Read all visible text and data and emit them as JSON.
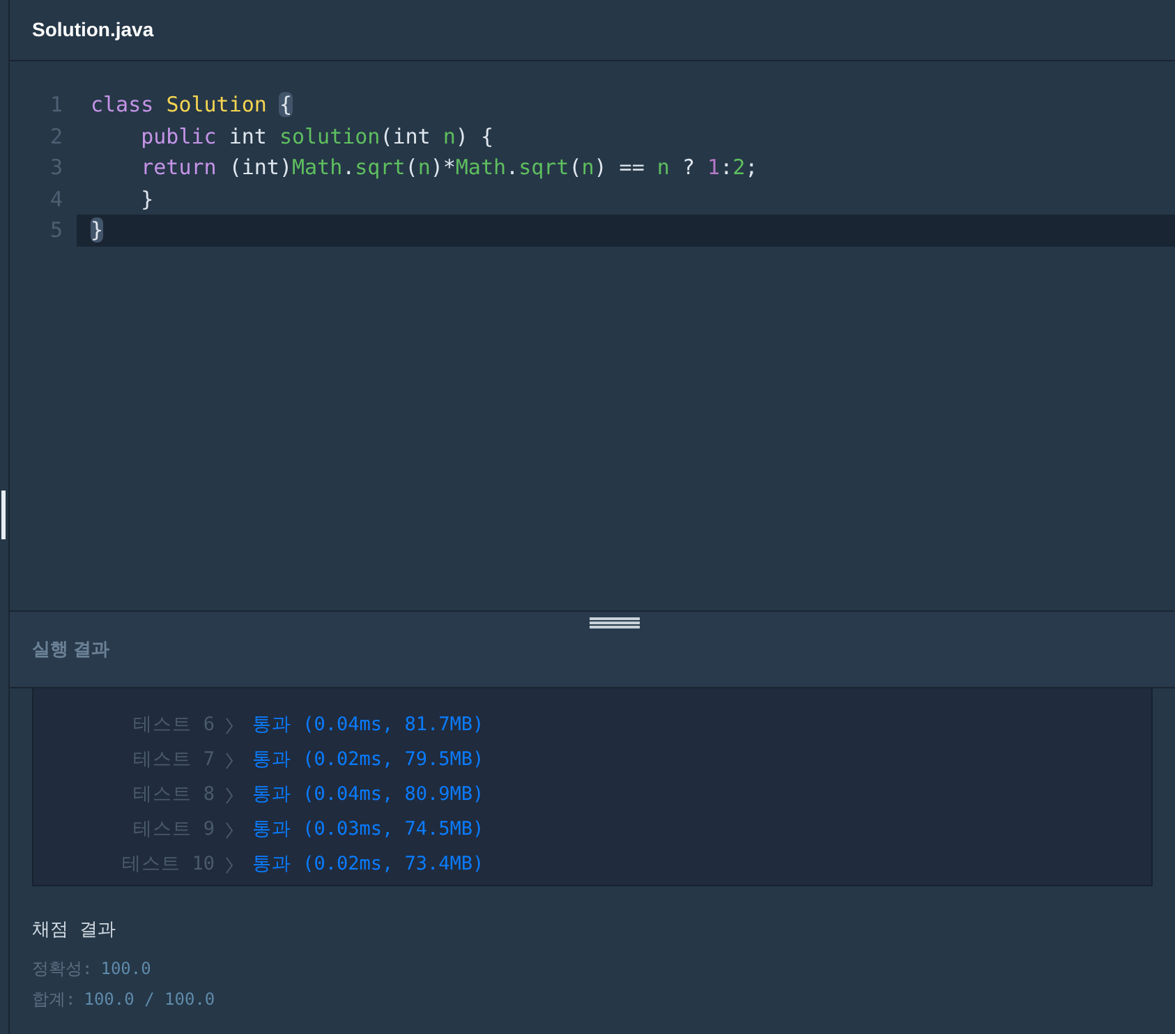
{
  "editor": {
    "file_tab": "Solution.java",
    "lines": [
      {
        "number": "1",
        "active": false,
        "tokens": [
          {
            "text": "class ",
            "kind": "keyword"
          },
          {
            "text": "Solution ",
            "kind": "type"
          },
          {
            "text": "{",
            "kind": "bracket"
          }
        ]
      },
      {
        "number": "2",
        "active": false,
        "tokens": [
          {
            "text": "    public",
            "kind": "keyword"
          },
          {
            "text": " int ",
            "kind": "plain"
          },
          {
            "text": "solution",
            "kind": "function"
          },
          {
            "text": "(int ",
            "kind": "plain"
          },
          {
            "text": "n",
            "kind": "function"
          },
          {
            "text": ") {",
            "kind": "plain"
          }
        ]
      },
      {
        "number": "3",
        "active": false,
        "tokens": [
          {
            "text": "    return",
            "kind": "keyword"
          },
          {
            "text": " (int)",
            "kind": "plain"
          },
          {
            "text": "Math",
            "kind": "function"
          },
          {
            "text": ".",
            "kind": "plain"
          },
          {
            "text": "sqrt",
            "kind": "function"
          },
          {
            "text": "(",
            "kind": "plain"
          },
          {
            "text": "n",
            "kind": "function"
          },
          {
            "text": ")*",
            "kind": "plain"
          },
          {
            "text": "Math",
            "kind": "function"
          },
          {
            "text": ".",
            "kind": "plain"
          },
          {
            "text": "sqrt",
            "kind": "function"
          },
          {
            "text": "(",
            "kind": "plain"
          },
          {
            "text": "n",
            "kind": "function"
          },
          {
            "text": ") == ",
            "kind": "plain"
          },
          {
            "text": "n",
            "kind": "function"
          },
          {
            "text": " ? ",
            "kind": "plain"
          },
          {
            "text": "1",
            "kind": "number"
          },
          {
            "text": ":",
            "kind": "plain"
          },
          {
            "text": "2",
            "kind": "function"
          },
          {
            "text": ";",
            "kind": "plain"
          }
        ]
      },
      {
        "number": "4",
        "active": false,
        "tokens": [
          {
            "text": "    }",
            "kind": "plain"
          }
        ]
      },
      {
        "number": "5",
        "active": true,
        "tokens": [
          {
            "text": "}",
            "kind": "bracket"
          }
        ]
      }
    ]
  },
  "run_results": {
    "title": "실행 결과",
    "rows": [
      {
        "test": "테스트 6",
        "result": "통과 (0.04ms, 81.7MB)"
      },
      {
        "test": "테스트 7",
        "result": "통과 (0.02ms, 79.5MB)"
      },
      {
        "test": "테스트 8",
        "result": "통과 (0.04ms, 80.9MB)"
      },
      {
        "test": "테스트 9",
        "result": "통과 (0.03ms, 74.5MB)"
      },
      {
        "test": "테스트 10",
        "result": "통과 (0.02ms, 73.4MB)"
      }
    ]
  },
  "grading": {
    "title": "채점 결과",
    "lines": [
      {
        "label": "정확성:",
        "value": "100.0"
      },
      {
        "label": "합계:",
        "value": "100.0 / 100.0"
      }
    ]
  }
}
